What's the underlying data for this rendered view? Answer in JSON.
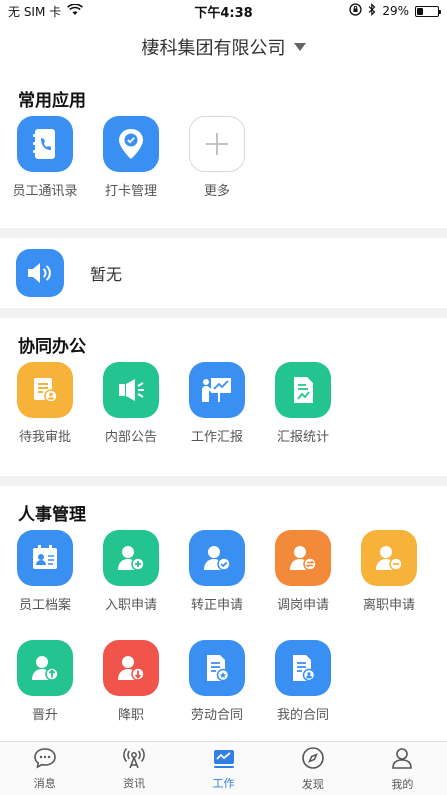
{
  "status_bar": {
    "carrier": "无 SIM 卡",
    "time": "下午4:38",
    "battery_pct": "29%",
    "battery_level": 0.29
  },
  "header": {
    "company": "棲科集团有限公司"
  },
  "common_apps": {
    "title": "常用应用",
    "items": [
      {
        "label": "员工通讯录",
        "icon": "contacts-book-icon"
      },
      {
        "label": "打卡管理",
        "icon": "location-check-icon"
      },
      {
        "label": "更多",
        "icon": "plus-icon"
      }
    ]
  },
  "notice": {
    "text": "暂无",
    "icon": "speaker-icon"
  },
  "collab": {
    "title": "协同办公",
    "items": [
      {
        "label": "待我审批",
        "icon": "approval-doc-icon"
      },
      {
        "label": "内部公告",
        "icon": "megaphone-icon"
      },
      {
        "label": "工作汇报",
        "icon": "presentation-icon"
      },
      {
        "label": "汇报统计",
        "icon": "report-stats-icon"
      }
    ]
  },
  "hr": {
    "title": "人事管理",
    "items": [
      {
        "label": "员工档案",
        "icon": "id-card-icon"
      },
      {
        "label": "入职申请",
        "icon": "user-add-icon"
      },
      {
        "label": "转正申请",
        "icon": "user-check-icon"
      },
      {
        "label": "调岗申请",
        "icon": "user-transfer-icon"
      },
      {
        "label": "离职申请",
        "icon": "user-remove-icon"
      },
      {
        "label": "晋升",
        "icon": "user-up-icon"
      },
      {
        "label": "降职",
        "icon": "user-down-icon"
      },
      {
        "label": "劳动合同",
        "icon": "contract-icon"
      },
      {
        "label": "我的合同",
        "icon": "my-contract-icon"
      }
    ]
  },
  "tabbar": {
    "items": [
      {
        "label": "消息",
        "icon": "chat-bubble-icon"
      },
      {
        "label": "资讯",
        "icon": "broadcast-icon"
      },
      {
        "label": "工作",
        "icon": "work-chart-icon"
      },
      {
        "label": "发现",
        "icon": "compass-icon"
      },
      {
        "label": "我的",
        "icon": "person-icon"
      }
    ],
    "active": "工作"
  },
  "colors": {
    "accent": "#2f7fe6",
    "blue": "#3a8ff2",
    "green": "#23c48f",
    "orange": "#f7b23a",
    "deeporange": "#f28a3a",
    "red": "#f0544a"
  }
}
